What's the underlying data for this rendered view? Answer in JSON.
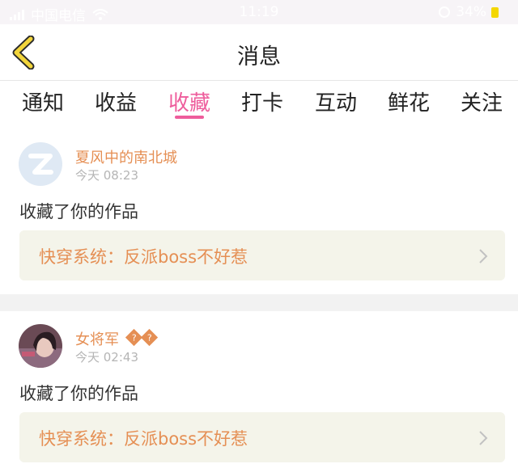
{
  "status_bar": {
    "carrier": "中国电信",
    "time": "11:19",
    "battery": "34%",
    "colors": {
      "battery_fill": "#f4d700"
    }
  },
  "nav": {
    "title": "消息",
    "back_icon": "chevron-left-icon"
  },
  "tabs": [
    {
      "label": "通知",
      "active": false
    },
    {
      "label": "收益",
      "active": false
    },
    {
      "label": "收藏",
      "active": true
    },
    {
      "label": "打卡",
      "active": false
    },
    {
      "label": "互动",
      "active": false
    },
    {
      "label": "鲜花",
      "active": false
    },
    {
      "label": "关注",
      "active": false
    }
  ],
  "messages": [
    {
      "username": "夏风中的南北城",
      "timestamp": "今天 08:23",
      "action": "收藏了你的作品",
      "work_title": "快穿系统：反派boss不好惹",
      "avatar_icon": "qq-default-avatar-icon"
    },
    {
      "username": "女将军",
      "badges": [
        "?",
        "?"
      ],
      "timestamp": "今天 02:43",
      "action": "收藏了你的作品",
      "work_title": "快穿系统：反派boss不好惹",
      "avatar_icon": "user-photo-avatar"
    }
  ],
  "colors": {
    "accent_pink": "#ee5d9c",
    "username_orange": "#e58f54",
    "back_icon_yellow": "#f2d53b",
    "link_background": "#f4f4ea",
    "divider": "#f2f2f2"
  }
}
